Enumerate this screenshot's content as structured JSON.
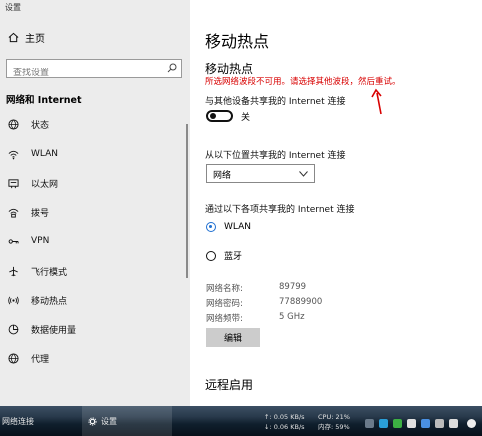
{
  "window": {
    "title": "设置"
  },
  "sidebar": {
    "home_label": "主页",
    "search_placeholder": "查找设置",
    "section_title": "网络和 Internet",
    "items": [
      {
        "label": "状态",
        "icon": "globe-icon"
      },
      {
        "label": "WLAN",
        "icon": "wifi-icon"
      },
      {
        "label": "以太网",
        "icon": "ethernet-icon"
      },
      {
        "label": "拨号",
        "icon": "dialup-icon"
      },
      {
        "label": "VPN",
        "icon": "vpn-icon"
      },
      {
        "label": "飞行模式",
        "icon": "airplane-icon"
      },
      {
        "label": "移动热点",
        "icon": "hotspot-icon"
      },
      {
        "label": "数据使用量",
        "icon": "data-usage-icon"
      },
      {
        "label": "代理",
        "icon": "proxy-globe-icon"
      }
    ]
  },
  "main": {
    "page_title": "移动热点",
    "section_title": "移动热点",
    "error_message": "所选网络波段不可用。请选择其他波段，然后重试。",
    "share_label": "与其他设备共享我的 Internet 连接",
    "toggle_state": "关",
    "share_from_label": "从以下位置共享我的 Internet 连接",
    "share_from_value": "网络",
    "share_over_label": "通过以下各项共享我的 Internet 连接",
    "options": [
      {
        "label": "WLAN",
        "selected": true
      },
      {
        "label": "蓝牙",
        "selected": false
      }
    ],
    "network_name_label": "网络名称:",
    "network_name_value": "89799",
    "network_password_label": "网络密码:",
    "network_password_value": "77889900",
    "network_band_label": "网络频带:",
    "network_band_value": "5 GHz",
    "edit_button": "编辑",
    "remote_title": "远程启用"
  },
  "taskbar": {
    "left_item": "网络连接",
    "active_item": "设置",
    "upload": "↑: 0.05 KB/s",
    "download": "↓: 0.06 KB/s",
    "cpu": "CPU: 21%",
    "memory": "内存: 59%"
  },
  "colors": {
    "error": "#d80000",
    "accent": "#1e6fd1",
    "sidebar_bg": "#ececec"
  }
}
